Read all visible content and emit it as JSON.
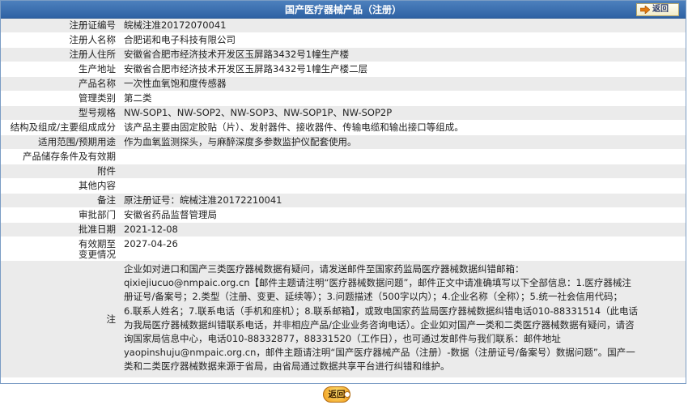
{
  "header": {
    "title": "国产医疗器械产品（注册）",
    "back_label": "返回"
  },
  "fields": [
    {
      "label": "注册证编号",
      "value": "皖械注准20172070041"
    },
    {
      "label": "注册人名称",
      "value": "合肥诺和电子科技有限公司"
    },
    {
      "label": "注册人住所",
      "value": "安徽省合肥市经济技术开发区玉屏路3432号1幢生产楼"
    },
    {
      "label": "生产地址",
      "value": "安徽省合肥市经济技术开发区玉屏路3432号1幢生产楼二层"
    },
    {
      "label": "产品名称",
      "value": "一次性血氧饱和度传感器"
    },
    {
      "label": "管理类别",
      "value": "第二类"
    },
    {
      "label": "型号规格",
      "value": "NW-SOP1、NW-SOP2、NW-SOP3、NW-SOP1P、NW-SOP2P"
    },
    {
      "label": "结构及组成/主要组成成分",
      "value": "该产品主要由固定胶贴（片）、发射器件、接收器件、传输电缆和输出接口等组成。"
    },
    {
      "label": "适用范围/预期用途",
      "value": "作为血氧监测探头，与麻醉深度多参数监护仪配套使用。"
    },
    {
      "label": "产品储存条件及有效期",
      "value": ""
    },
    {
      "label": "附件",
      "value": ""
    },
    {
      "label": "其他内容",
      "value": ""
    },
    {
      "label": "备注",
      "value": "原注册证号：皖械注准20172210041"
    },
    {
      "label": "审批部门",
      "value": "安徽省药品监督管理局"
    },
    {
      "label": "批准日期",
      "value": "2021-12-08"
    },
    {
      "label": "有效期至",
      "value": "2027-04-26"
    },
    {
      "label": "变更情况",
      "value": ""
    }
  ],
  "note": {
    "label": "注",
    "lines": [
      "企业如对进口和国产三类医疗器械数据有疑问，请发送邮件至国家药监局医疗器械数据纠错邮箱：",
      "qixiejiucuo@nmpaic.org.cn【邮件主题请注明“医疗器械数据问题”，邮件正文中请准确填写以下全部信息：1.医疗器械注",
      "册证号/备案号；2.类型（注册、变更、延续等）；3.问题描述（500字以内）；4.企业名称（全称）；5.统一社会信用代码；",
      "6.联系人姓名；7.联系电话（手机和座机）；8.联系邮箱】，或致电国家药监局医疗器械数据纠错电话010-88331514（此电话",
      "为我局医疗器械数据纠错联系电话，并非相应产品/企业业务咨询电话）。企业如对国产一类和二类医疗器械数据有疑问，请咨",
      "询国家局信息中心，电话010-88332877，88331520（工作日），也可通过发邮件与我们联系：邮件地址",
      "yaopinshuju@nmpaic.org.cn，邮件主题请注明“国产医疗器械产品（注册）-数据（注册证号/备案号）数据问题”。国产一",
      "类和二类医疗器械数据来源于省局，由省局通过数据共享平台进行纠错和维护。"
    ]
  },
  "footer": {
    "back_label": "返回"
  },
  "colors": {
    "header_bg": "#3a6eb0",
    "row_shade": "#ebebeb",
    "border": "#7a9cc4"
  }
}
